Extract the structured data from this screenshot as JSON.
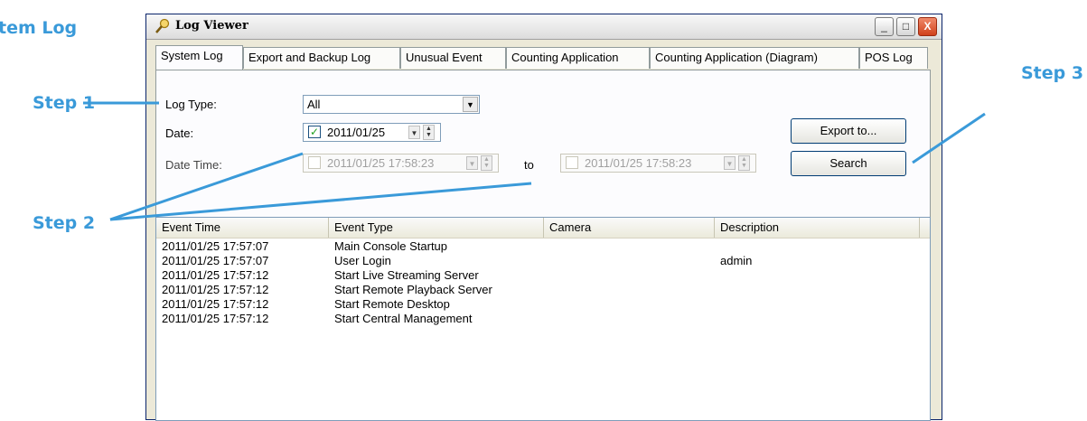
{
  "annotations": {
    "system_log_label": "tem Log",
    "step1": "Step 1",
    "step2": "Step 2",
    "step3": "Step 3"
  },
  "window": {
    "title": "Log Viewer",
    "controls": {
      "minimize": "_",
      "maximize": "□",
      "close": "X"
    }
  },
  "tabs": [
    {
      "label": "System Log",
      "active": true
    },
    {
      "label": "Export and Backup Log",
      "active": false
    },
    {
      "label": "Unusual Event",
      "active": false
    },
    {
      "label": "Counting Application",
      "active": false
    },
    {
      "label": "Counting Application (Diagram)",
      "active": false
    },
    {
      "label": "POS Log",
      "active": false
    }
  ],
  "filters": {
    "log_type_label": "Log Type:",
    "log_type_value": "All",
    "date_label": "Date:",
    "date_value": "2011/01/25",
    "date_checked": true,
    "datetime_label": "Date Time:",
    "datetime_from": "2011/01/25 17:58:23",
    "datetime_to": "2011/01/25 17:58:23",
    "to_label": "to",
    "export_button": "Export to...",
    "search_button": "Search"
  },
  "table": {
    "columns": [
      "Event Time",
      "Event Type",
      "Camera",
      "Description"
    ],
    "rows": [
      [
        "2011/01/25 17:57:07",
        "Main Console Startup",
        "",
        ""
      ],
      [
        "2011/01/25 17:57:07",
        "User Login",
        "",
        "admin"
      ],
      [
        "2011/01/25 17:57:12",
        "Start Live Streaming Server",
        "",
        ""
      ],
      [
        "2011/01/25 17:57:12",
        "Start Remote Playback Server",
        "",
        ""
      ],
      [
        "2011/01/25 17:57:12",
        "Start Remote Desktop",
        "",
        ""
      ],
      [
        "2011/01/25 17:57:12",
        "Start Central Management",
        "",
        ""
      ]
    ]
  },
  "colors": {
    "callout": "#3a9ad9",
    "window_bg": "#ece9d8",
    "close_button": "#d0401c",
    "panel_bg": "#fcfcfe"
  }
}
